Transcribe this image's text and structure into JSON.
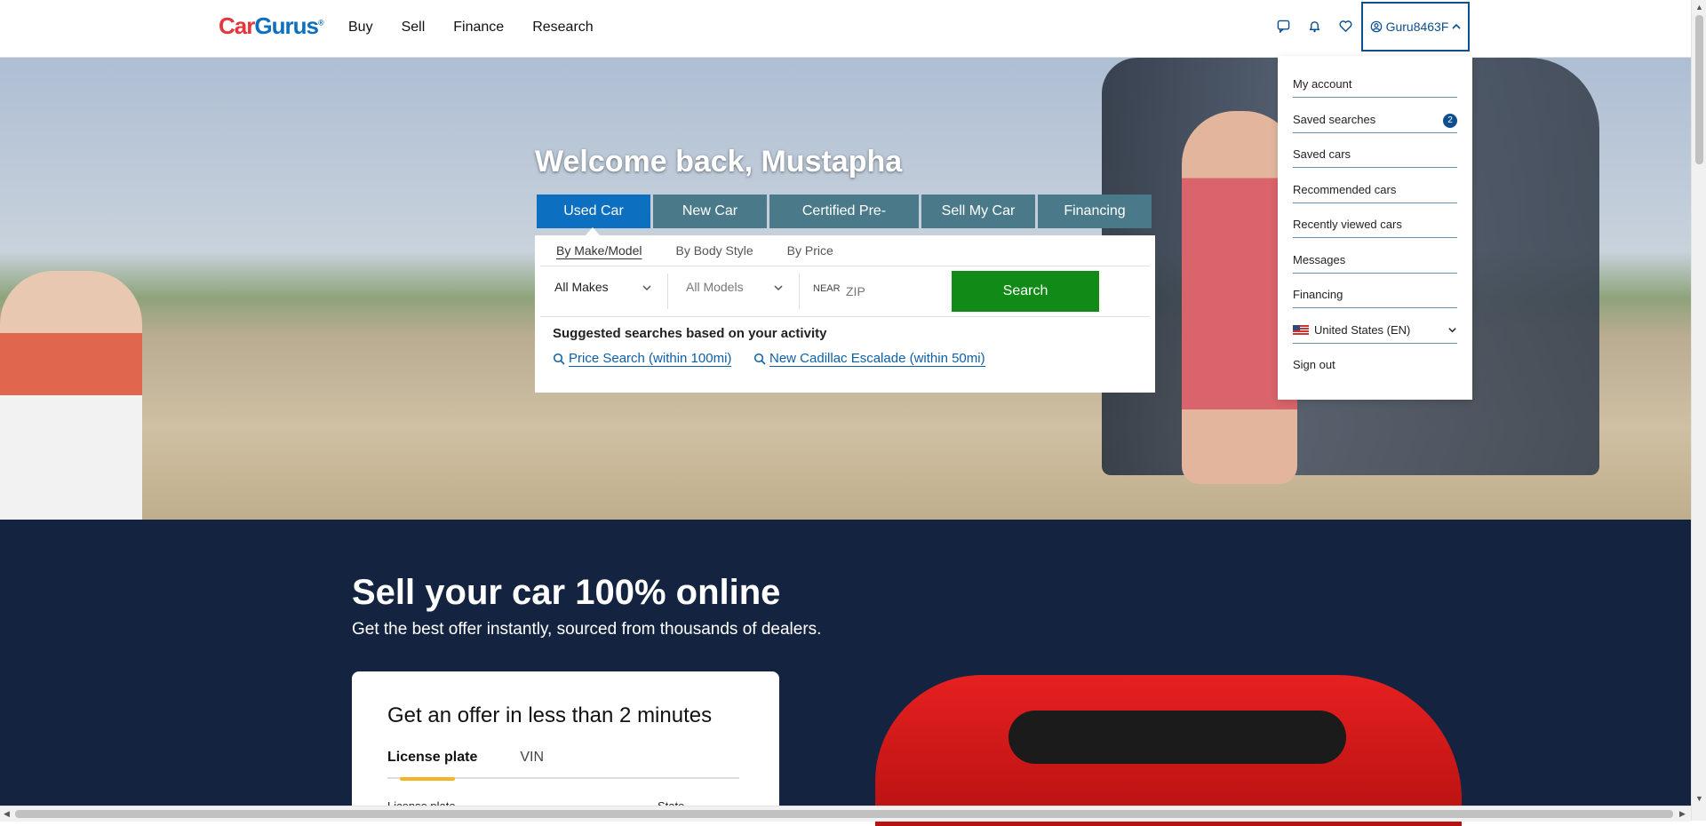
{
  "header": {
    "logo": {
      "car": "Car",
      "gurus": "Gurus",
      "mark": "®"
    },
    "nav": [
      "Buy",
      "Sell",
      "Finance",
      "Research"
    ],
    "icons": [
      "chat-icon",
      "bell-icon",
      "heart-icon"
    ],
    "user": {
      "label": "Guru8463F"
    }
  },
  "hero": {
    "welcome": "Welcome back, Mustapha",
    "tabs": [
      "Used Car",
      "New Car",
      "Certified Pre-Owned",
      "Sell My Car",
      "Financing"
    ],
    "active_tab": "Used Car",
    "subtabs": [
      "By Make/Model",
      "By Body Style",
      "By Price"
    ],
    "makes": "All Makes",
    "models": "All Models",
    "near": "NEAR",
    "zip_placeholder": "ZIP",
    "search": "Search",
    "suggested_title": "Suggested searches based on your activity",
    "suggested": [
      "Price Search (within 100mi)",
      "New Cadillac Escalade (within 50mi)"
    ]
  },
  "menu": {
    "items": [
      "My account",
      "Saved searches",
      "Saved cars",
      "Recommended cars",
      "Recently viewed cars",
      "Messages",
      "Financing"
    ],
    "saved_searches_count": "2",
    "region": "United States (EN)",
    "sign_out": "Sign out"
  },
  "sell": {
    "title": "Sell your car 100% online",
    "subtitle": "Get the best offer instantly, sourced from thousands of dealers.",
    "card_title": "Get an offer in less than 2 minutes",
    "tabs": [
      "License plate",
      "VIN"
    ],
    "field_license": "License plate",
    "field_state": "State"
  },
  "colors": {
    "brand_blue": "#0d6fbf",
    "search_green": "#118a17",
    "dark_navy": "#142440"
  }
}
